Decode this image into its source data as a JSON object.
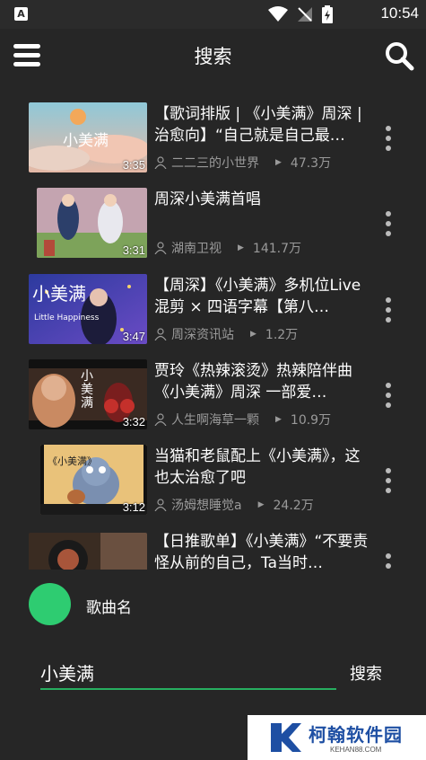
{
  "status_bar": {
    "app_icon_letter": "A",
    "time": "10:54",
    "icons": [
      "wifi-icon",
      "no-signal-icon",
      "battery-charging-icon"
    ]
  },
  "header": {
    "title": "搜索",
    "menu_icon": "hamburger-menu-icon",
    "search_icon": "search-icon"
  },
  "results": [
    {
      "title": "【歌词排版 | 《小美满》周深 | 治愈向】“自己就是自己最…",
      "thumb_text": "小美满",
      "duration": "3:35",
      "author": "二二三的小世界",
      "plays": "47.3万"
    },
    {
      "title": "周深小美满首唱",
      "thumb_text": "",
      "duration": "3:31",
      "author": "湖南卫视",
      "plays": "141.7万"
    },
    {
      "title": "【周深】《小美满》多机位Live混剪 × 四语字幕【第八…",
      "thumb_text": "小美满",
      "thumb_subtext": "Little Happiness",
      "duration": "3:47",
      "author": "周深资讯站",
      "plays": "1.2万"
    },
    {
      "title": "贾玲《热辣滚烫》热辣陪伴曲 《小美满》周深 一部爱…",
      "thumb_text": "小美满",
      "duration": "3:32",
      "author": "人生啊海草一颗",
      "plays": "10.9万"
    },
    {
      "title": "当猫和老鼠配上《小美满》，这也太治愈了吧",
      "thumb_text": "《小美满》",
      "duration": "3:12",
      "author": "汤姆想睡觉a",
      "plays": "24.2万"
    },
    {
      "title": "【日推歌单】《小美满》“不要责怪从前的自己，Ta当时…",
      "thumb_text": "",
      "duration": "",
      "author": "",
      "plays": ""
    }
  ],
  "player": {
    "song_name": "歌曲名",
    "disc_color": "#2ecc71"
  },
  "search": {
    "value": "小美满",
    "submit_label": "搜索",
    "accent": "#27ae60"
  },
  "watermark": {
    "text": "柯翰软件园",
    "subtext": "KEHAN88.COM"
  },
  "colors": {
    "background": "#262626",
    "meta_text": "#9a9a9a"
  }
}
